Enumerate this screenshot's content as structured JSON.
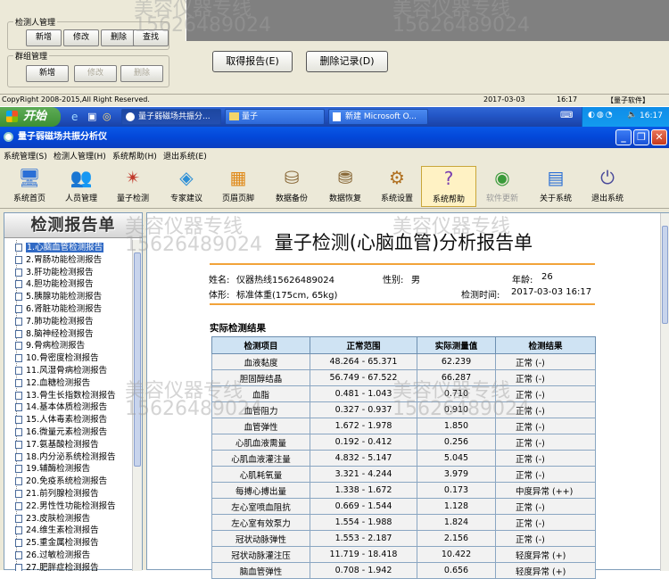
{
  "top_app": {
    "group_tester": {
      "title": "检测人管理",
      "buttons": [
        "新增",
        "修改",
        "删除",
        "查找"
      ]
    },
    "group_group": {
      "title": "群组管理",
      "buttons": [
        "新增",
        "修改",
        "删除"
      ]
    },
    "btn_get_report": "取得报告(E)",
    "btn_delete_record": "删除记录(D)",
    "status": {
      "copyright": "CopyRight 2008-2015,All Right Reserved.",
      "date": "2017-03-03",
      "time": "16:17",
      "brand": "【量子软件】"
    }
  },
  "taskbar": {
    "start": "开始",
    "tasks": [
      "量子弱磁场共振分...",
      "量子",
      "新建 Microsoft O..."
    ],
    "time": "16:17"
  },
  "window": {
    "title": "量子弱磁场共振分析仪",
    "menu": [
      "系统管理(S)",
      "检测人管理(H)",
      "系统帮助(H)",
      "退出系统(E)"
    ],
    "toolbar": [
      {
        "label": "系统首页",
        "icon": "home-icon",
        "glyph": "🖥"
      },
      {
        "label": "人员管理",
        "icon": "users-icon",
        "glyph": "👥"
      },
      {
        "label": "量子检测",
        "icon": "quantum-icon",
        "glyph": "✴"
      },
      {
        "label": "专家建议",
        "icon": "expert-icon",
        "glyph": "◈"
      },
      {
        "label": "页眉页脚",
        "icon": "header-footer-icon",
        "glyph": "▦"
      },
      {
        "label": "数据备份",
        "icon": "backup-icon",
        "glyph": "⛁"
      },
      {
        "label": "数据恢复",
        "icon": "restore-icon",
        "glyph": "⛃"
      },
      {
        "label": "系统设置",
        "icon": "settings-icon",
        "glyph": "⚙"
      },
      {
        "label": "系统帮助",
        "icon": "help-icon",
        "glyph": "?"
      },
      {
        "label": "软件更新",
        "icon": "update-icon",
        "glyph": "◉"
      },
      {
        "label": "关于系统",
        "icon": "about-icon",
        "glyph": "▤"
      },
      {
        "label": "退出系统",
        "icon": "exit-icon",
        "glyph": "⏻"
      }
    ]
  },
  "left_panel": {
    "header": "检测报告单",
    "items": [
      "1.心脑血管检测报告",
      "2.胃肠功能检测报告",
      "3.肝功能检测报告",
      "4.胆功能检测报告",
      "5.胰腺功能检测报告",
      "6.肾脏功能检测报告",
      "7.肺功能检测报告",
      "8.脑神经检测报告",
      "9.骨病检测报告",
      "10.骨密度检测报告",
      "11.风湿骨病检测报告",
      "12.血糖检测报告",
      "13.骨生长指数检测报告",
      "14.基本体质检测报告",
      "15.人体毒素检测报告",
      "16.微量元素检测报告",
      "17.氨基酸检测报告",
      "18.内分泌系统检测报告",
      "19.辅酶检测报告",
      "20.免疫系统检测报告",
      "21.前列腺检测报告",
      "22.男性性功能检测报告",
      "23.皮肤检测报告",
      "24.维生素检测报告",
      "25.重金属检测报告",
      "26.过敏检测报告",
      "27.肥胖症检测报告"
    ]
  },
  "report": {
    "title": "量子检测(心脑血管)分析报告单",
    "name_label": "姓名:",
    "name": "仪器热线15626489024",
    "gender_label": "性别:",
    "gender": "男",
    "age_label": "年龄:",
    "age": "26",
    "body_label": "体形:",
    "body": "标准体重(175cm, 65kg)",
    "time_label": "检测时间:",
    "time": "2017-03-03 16:17",
    "section": "实际检测结果",
    "columns": [
      "检测项目",
      "正常范围",
      "实际测量值",
      "检测结果"
    ],
    "rows": [
      [
        "血液黏度",
        "48.264 - 65.371",
        "62.239",
        "正常 (-)"
      ],
      [
        "胆固醇结晶",
        "56.749 - 67.522",
        "66.287",
        "正常 (-)"
      ],
      [
        "血脂",
        "0.481 - 1.043",
        "0.710",
        "正常 (-)"
      ],
      [
        "血管阻力",
        "0.327 - 0.937",
        "0.910",
        "正常 (-)"
      ],
      [
        "血管弹性",
        "1.672 - 1.978",
        "1.850",
        "正常 (-)"
      ],
      [
        "心肌血液需量",
        "0.192 - 0.412",
        "0.256",
        "正常 (-)"
      ],
      [
        "心肌血液灌注量",
        "4.832 - 5.147",
        "5.045",
        "正常 (-)"
      ],
      [
        "心肌耗氧量",
        "3.321 - 4.244",
        "3.979",
        "正常 (-)"
      ],
      [
        "每搏心搏出量",
        "1.338 - 1.672",
        "0.173",
        "中度异常 (++)"
      ],
      [
        "左心室喷血阻抗",
        "0.669 - 1.544",
        "1.128",
        "正常 (-)"
      ],
      [
        "左心室有效泵力",
        "1.554 - 1.988",
        "1.824",
        "正常 (-)"
      ],
      [
        "冠状动脉弹性",
        "1.553 - 2.187",
        "2.156",
        "正常 (-)"
      ],
      [
        "冠状动脉灌注压",
        "11.719 - 18.418",
        "10.422",
        "轻度异常 (+)"
      ],
      [
        "脑血管弹性",
        "0.708 - 1.942",
        "0.656",
        "轻度异常 (+)"
      ]
    ]
  },
  "watermark": {
    "text1": "美容仪器专线",
    "text2": "15626489024"
  }
}
